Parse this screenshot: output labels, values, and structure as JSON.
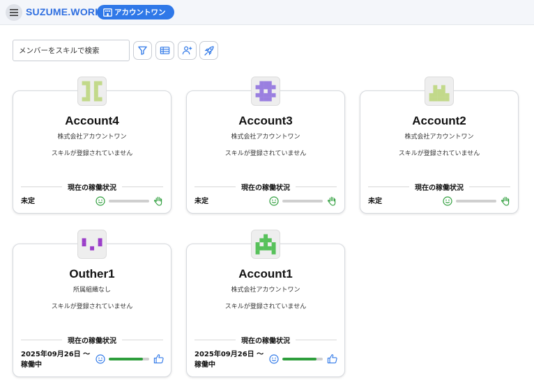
{
  "app": {
    "brand": "SUZUME.WORK",
    "org_name": "アカウントワン"
  },
  "search": {
    "placeholder": "メンバーをスキルで検索"
  },
  "section_label": "現在の稼働状況",
  "colors": {
    "brand": "#2f6fe0",
    "pill": "#2f78e8",
    "active": "#2e9e3c",
    "idle": "#cfcfcf",
    "icon_green": "#2e9e3c",
    "icon_blue": "#2f78e8"
  },
  "toolbar": [
    "filter-icon",
    "table-view-icon",
    "add-member-icon",
    "rocket-icon"
  ],
  "members": [
    {
      "name": "Account4",
      "org": "株式会社アカウントワン",
      "skills": "スキルが登録されていません",
      "status": "未定",
      "status_line2": "",
      "utilization": 0,
      "action_icon": "raised-hand-icon",
      "avatar_color": "#c2d98a",
      "avatar_pattern": "glyph4"
    },
    {
      "name": "Account3",
      "org": "株式会社アカウントワン",
      "skills": "スキルが登録されていません",
      "status": "未定",
      "status_line2": "",
      "utilization": 0,
      "action_icon": "raised-hand-icon",
      "avatar_color": "#9a7fe0",
      "avatar_pattern": "glyph3"
    },
    {
      "name": "Account2",
      "org": "株式会社アカウントワン",
      "skills": "スキルが登録されていません",
      "status": "未定",
      "status_line2": "",
      "utilization": 0,
      "action_icon": "raised-hand-icon",
      "avatar_color": "#c2d98a",
      "avatar_pattern": "glyph2"
    },
    {
      "name": "Outher1",
      "org": "所属組織なし",
      "skills": "スキルが登録されていません",
      "status": "2025年09月26日 〜",
      "status_line2": "稼働中",
      "utilization": 0.85,
      "action_icon": "thumbs-up-icon",
      "avatar_color": "#9b3fc9",
      "avatar_pattern": "glyph1o"
    },
    {
      "name": "Account1",
      "org": "株式会社アカウントワン",
      "skills": "スキルが登録されていません",
      "status": "2025年09月26日 〜",
      "status_line2": "稼働中",
      "utilization": 0.85,
      "action_icon": "thumbs-up-icon",
      "avatar_color": "#57c15a",
      "avatar_pattern": "glyph1"
    }
  ]
}
